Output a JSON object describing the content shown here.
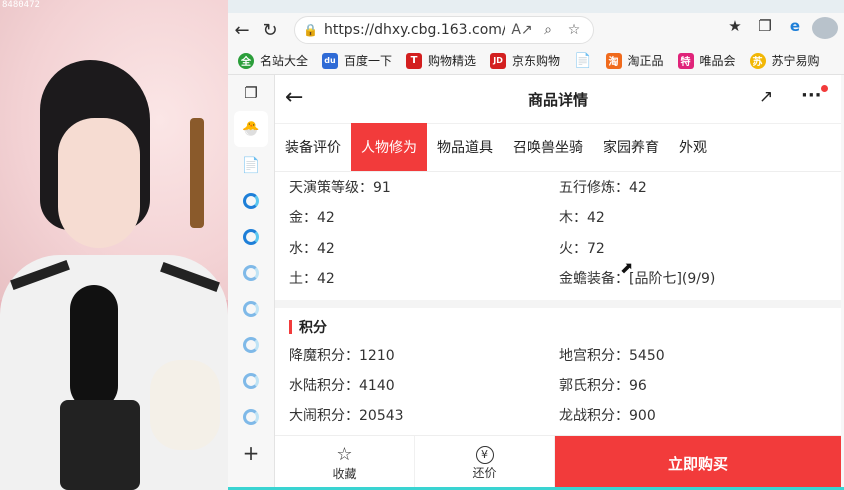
{
  "video": {
    "room_id": "8480472"
  },
  "browser": {
    "url": "https://dhxy.cbg.163.com/c...",
    "favorites": [
      {
        "label": "名站大全",
        "color": "#2b9e3a",
        "glyph": "全"
      },
      {
        "label": "百度一下",
        "color": "#2f6bd6",
        "glyph": "du"
      },
      {
        "label": "购物精选",
        "color": "#d31f1f",
        "glyph": "T"
      },
      {
        "label": "京东购物",
        "color": "#d31f1f",
        "glyph": "JD"
      },
      {
        "label": "淘正品",
        "color": "#f06a1c",
        "glyph": "淘"
      },
      {
        "label": "唯品会",
        "color": "#e0247a",
        "glyph": "特"
      },
      {
        "label": "苏宁易购",
        "color": "#f2b705",
        "glyph": "苏"
      }
    ]
  },
  "page": {
    "title": "商品详情",
    "tabs": [
      "装备评价",
      "人物修为",
      "物品道具",
      "召唤兽坐骑",
      "家园养育",
      "外观"
    ],
    "active_tab": 1,
    "stats": [
      {
        "left": "天演策等级：91",
        "right": "五行修炼：42"
      },
      {
        "left": "金：42",
        "right": "木：42"
      },
      {
        "left": "水：42",
        "right": "火：72"
      },
      {
        "left": "土：42",
        "right": "金蟾装备：[品阶七](9/9)"
      }
    ],
    "score_section": {
      "title": "积分",
      "rows": [
        {
          "left": "降魔积分：1210",
          "right": "地宫积分：5450"
        },
        {
          "left": "水陆积分：4140",
          "right": "郭氏积分：96"
        },
        {
          "left": "大闹积分：20543",
          "right": "龙战积分：900"
        }
      ]
    },
    "bottom": {
      "favorite": "收藏",
      "bargain": "还价",
      "buy": "立即购买",
      "bargain_glyph": "¥"
    }
  }
}
